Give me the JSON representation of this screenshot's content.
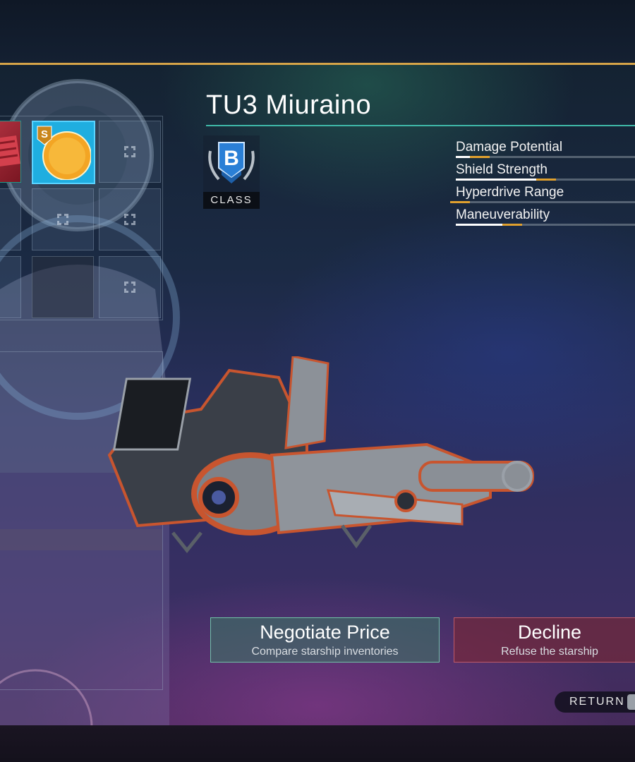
{
  "ship": {
    "name": "TU3 Miuraino",
    "class_grade": "B",
    "class_label": "CLASS"
  },
  "stats": [
    {
      "label": "Damage Potential",
      "level": 0.19
    },
    {
      "label": "Shield Strength",
      "level": 0.56
    },
    {
      "label": "Hyperdrive Range",
      "level": 0.08
    },
    {
      "label": "Maneuverability",
      "level": 0.37
    }
  ],
  "inventory": {
    "items": [
      {
        "icon": "red-module-icon"
      },
      {
        "icon": "salvage-coin-icon",
        "badge": "S"
      }
    ]
  },
  "actions": {
    "negotiate": {
      "label": "Negotiate Price",
      "sublabel": "Compare starship inventories"
    },
    "decline": {
      "label": "Decline",
      "sublabel": "Refuse the starship"
    }
  },
  "footer": {
    "return_label": "RETURN"
  },
  "colors": {
    "accent_gold": "#d6a448",
    "rule_teal": "#3fb8a8",
    "negotiate_green": "#6fc3a6",
    "decline_red": "#c05a68"
  }
}
